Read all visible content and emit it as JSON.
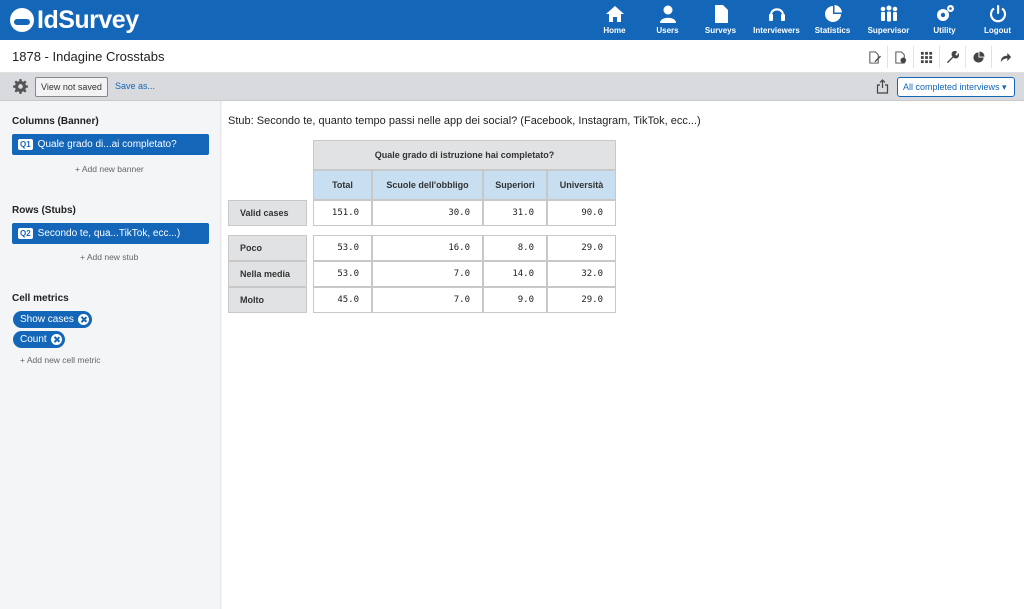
{
  "brand": {
    "name": "IdSurvey",
    "color": "#1466b8"
  },
  "nav": [
    {
      "label": "Home",
      "icon": "home-icon"
    },
    {
      "label": "Users",
      "icon": "users-icon"
    },
    {
      "label": "Surveys",
      "icon": "document-icon"
    },
    {
      "label": "Interviewers",
      "icon": "headset-icon"
    },
    {
      "label": "Statistics",
      "icon": "pie-chart-icon"
    },
    {
      "label": "Supervisor",
      "icon": "group-icon"
    },
    {
      "label": "Utility",
      "icon": "gears-icon"
    },
    {
      "label": "Logout",
      "icon": "power-icon"
    }
  ],
  "page": {
    "title": "1878 - Indagine Crosstabs"
  },
  "toolbar": {
    "view_label": "View not saved",
    "save_as_label": "Save as...",
    "filter_label": "All completed interviews ▾"
  },
  "sidebar": {
    "columns_title": "Columns (Banner)",
    "banner_tag": "Q1",
    "banner_label": "Quale grado di...ai completato?",
    "add_banner": "+ Add new banner",
    "rows_title": "Rows (Stubs)",
    "stub_tag": "Q2",
    "stub_label": "Secondo te, qua...TikTok, ecc...)",
    "add_stub": "+ Add new stub",
    "metrics_title": "Cell metrics",
    "metrics": [
      "Show cases",
      "Count"
    ],
    "add_metric": "+ Add new cell metric"
  },
  "crosstab": {
    "stub_title": "Stub: Secondo te, quanto tempo passi nelle app dei social? (Facebook, Instagram, TikTok, ecc...)",
    "banner_title": "Quale grado di istruzione hai completato?",
    "columns": [
      "Total",
      "Scuole dell'obbligo",
      "Superiori",
      "Università"
    ],
    "valid_row": {
      "label": "Valid cases",
      "values": [
        "151.0",
        "30.0",
        "31.0",
        "90.0"
      ]
    },
    "rows": [
      {
        "label": "Poco",
        "values": [
          "53.0",
          "16.0",
          "8.0",
          "29.0"
        ]
      },
      {
        "label": "Nella media",
        "values": [
          "53.0",
          "7.0",
          "14.0",
          "32.0"
        ]
      },
      {
        "label": "Molto",
        "values": [
          "45.0",
          "7.0",
          "9.0",
          "29.0"
        ]
      }
    ]
  }
}
